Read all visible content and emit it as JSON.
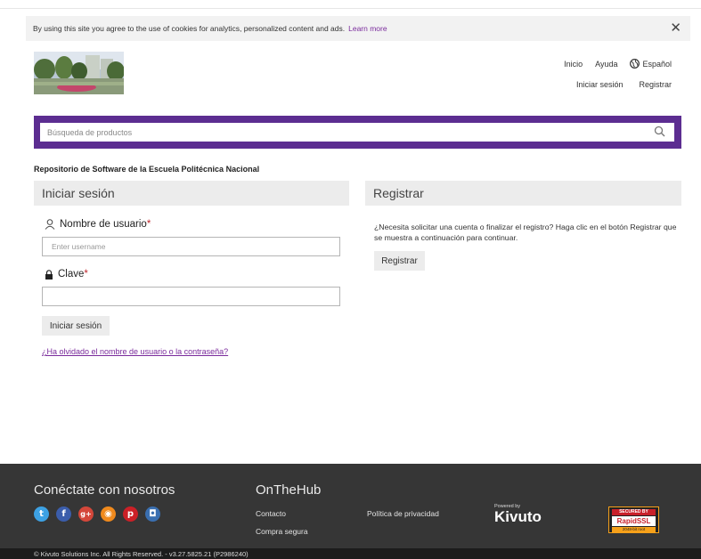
{
  "cookie": {
    "text": "By using this site you agree to the use of cookies for analytics, personalized content and ads.",
    "link": "Learn more",
    "close": "✕"
  },
  "nav": {
    "inicio": "Inicio",
    "ayuda": "Ayuda",
    "language": "Español",
    "iniciar_sesion": "Iniciar sesión",
    "registrar": "Registrar"
  },
  "search": {
    "placeholder": "Búsqueda de productos"
  },
  "repo_title": "Repositorio de Software de la Escuela Politécnica Nacional",
  "login": {
    "heading": "Iniciar sesión",
    "username_label": "Nombre de usuario",
    "username_placeholder": "Enter username",
    "password_label": "Clave",
    "required_mark": "*",
    "submit": "Iniciar sesión",
    "forgot": "¿Ha olvidado el nombre de usuario o la contraseña?"
  },
  "register": {
    "heading": "Registrar",
    "text": "¿Necesita solicitar una cuenta o finalizar el registro? Haga clic en el botón Registrar que se muestra a continuación para continuar.",
    "button": "Registrar"
  },
  "footer": {
    "connect": "Conéctate con nosotros",
    "social": [
      {
        "icon": "twitter-icon",
        "glyph": "t",
        "color": "#3da1e3"
      },
      {
        "icon": "facebook-icon",
        "glyph": "f",
        "color": "#3b5dab"
      },
      {
        "icon": "google-plus-icon",
        "glyph": "g+",
        "color": "#d4473a"
      },
      {
        "icon": "rss-icon",
        "glyph": "◉",
        "color": "#f08a1d"
      },
      {
        "icon": "pinterest-icon",
        "glyph": "p",
        "color": "#cb2027"
      },
      {
        "icon": "instagram-icon",
        "glyph": "◘",
        "color": "#3a6fb0"
      }
    ],
    "onthehub": "OnTheHub",
    "contacto": "Contacto",
    "compra_segura": "Compra segura",
    "privacidad": "Política de privacidad",
    "powered_by": "Powered by",
    "kivuto": "Kivuto",
    "ssl_secured": "SECURED BY",
    "ssl_name": "RapidSSL",
    "ssl_root": "2048-bit root",
    "copyright": "© Kivuto Solutions Inc. All Rights Reserved. - v3.27.5825.21 (P2986240)"
  },
  "colors": {
    "accent": "#5c2d91",
    "link": "#7a2b9c",
    "required": "#c0282e"
  }
}
